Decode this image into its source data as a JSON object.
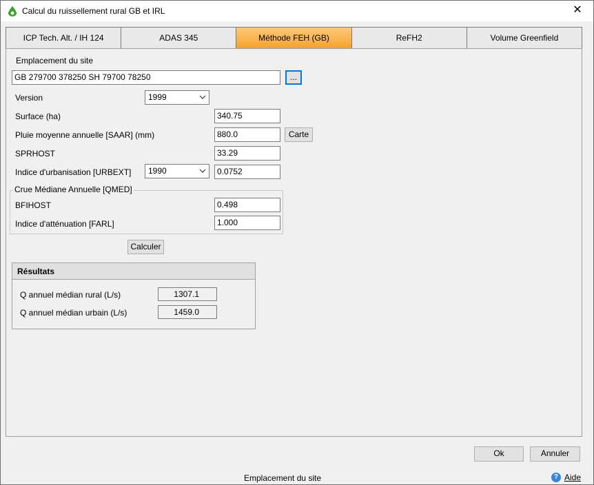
{
  "window": {
    "title": "Calcul du ruissellement rural GB et IRL",
    "close_glyph": "✕"
  },
  "tabs": [
    {
      "label": "ICP Tech. Alt. / IH 124",
      "active": false
    },
    {
      "label": "ADAS 345",
      "active": false
    },
    {
      "label": "Méthode FEH (GB)",
      "active": true
    },
    {
      "label": "ReFH2",
      "active": false
    },
    {
      "label": "Volume Greenfield",
      "active": false
    }
  ],
  "site": {
    "label": "Emplacement du site",
    "value": "GB 279700 378250 SH 79700 78250",
    "browse_label": "..."
  },
  "form": {
    "version_label": "Version",
    "version_value": "1999",
    "surface_label": "Surface (ha)",
    "surface_value": "340.75",
    "saar_label": "Pluie moyenne annuelle [SAAR] (mm)",
    "saar_value": "880.0",
    "carte_label": "Carte",
    "sprhost_label": "SPRHOST",
    "sprhost_value": "33.29",
    "urbext_label": "Indice d'urbanisation [URBEXT]",
    "urbext_year": "1990",
    "urbext_value": "0.0752"
  },
  "qmed": {
    "title": "Crue Médiane Annuelle [QMED]",
    "bfihost_label": "BFIHOST",
    "bfihost_value": "0.498",
    "farl_label": "Indice d'atténuation [FARL]",
    "farl_value": "1.000"
  },
  "calculer_label": "Calculer",
  "results": {
    "title": "Résultats",
    "rural_label": "Q annuel médian rural (L/s)",
    "rural_value": "1307.1",
    "urbain_label": "Q annuel médian urbain (L/s)",
    "urbain_value": "1459.0"
  },
  "footer": {
    "ok_label": "Ok",
    "annuler_label": "Annuler",
    "status_text": "Emplacement du site",
    "help_label": "Aide",
    "help_icon_glyph": "?"
  },
  "colors": {
    "active_tab": "#f4a32b",
    "focus_border": "#0078d7",
    "help_icon": "#3a86d4"
  }
}
